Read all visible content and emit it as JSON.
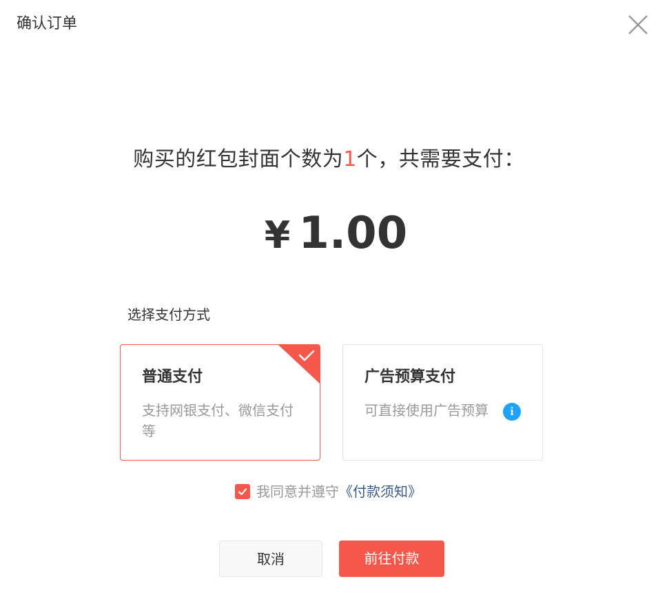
{
  "dialog": {
    "title": "确认订单"
  },
  "summary": {
    "prefix": "购买的红包封面个数为",
    "count": "1",
    "suffix": "个，共需要支付："
  },
  "amount": {
    "currency": "¥",
    "value": "1.00"
  },
  "payment": {
    "section_label": "选择支付方式",
    "selected": "normal",
    "options": [
      {
        "key": "normal",
        "title": "普通支付",
        "desc": "支持网银支付、微信支付等",
        "selected": true
      },
      {
        "key": "ad",
        "title": "广告预算支付",
        "desc": "可直接使用广告预算",
        "selected": false,
        "info_icon": "i"
      }
    ]
  },
  "agreement": {
    "checked": true,
    "text": "我同意并遵守",
    "link": "《付款须知》"
  },
  "buttons": {
    "cancel": "取消",
    "pay": "前往付款"
  },
  "colors": {
    "accent": "#f5584a",
    "info": "#1ea4ff",
    "link": "#3a5a8c",
    "muted": "#999999",
    "text": "#333333"
  }
}
